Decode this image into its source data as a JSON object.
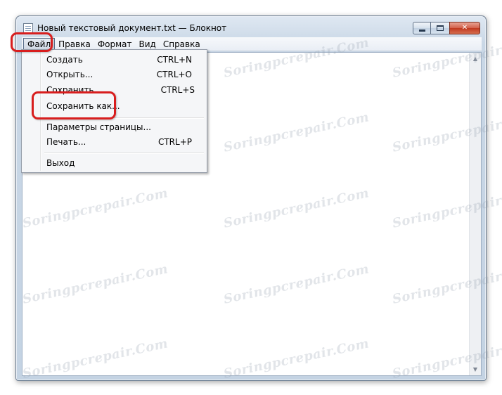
{
  "window": {
    "title": "Новый текстовый документ.txt — Блокнот",
    "close_glyph": "✕"
  },
  "menubar": {
    "items": [
      "Файл",
      "Правка",
      "Формат",
      "Вид",
      "Справка"
    ]
  },
  "file_menu": {
    "items": [
      {
        "label": "Создать",
        "shortcut": "CTRL+N"
      },
      {
        "label": "Открыть...",
        "shortcut": "CTRL+O"
      },
      {
        "label": "Сохранить",
        "shortcut": "CTRL+S"
      },
      {
        "label": "Сохранить как...",
        "shortcut": ""
      },
      {
        "label": "Параметры страницы...",
        "shortcut": ""
      },
      {
        "label": "Печать...",
        "shortcut": "CTRL+P"
      },
      {
        "label": "Выход",
        "shortcut": ""
      }
    ]
  },
  "watermark": "Soringpcrepair.Com",
  "colors": {
    "highlight": "#d81e1e",
    "menu_background": "#f5f6f8"
  }
}
